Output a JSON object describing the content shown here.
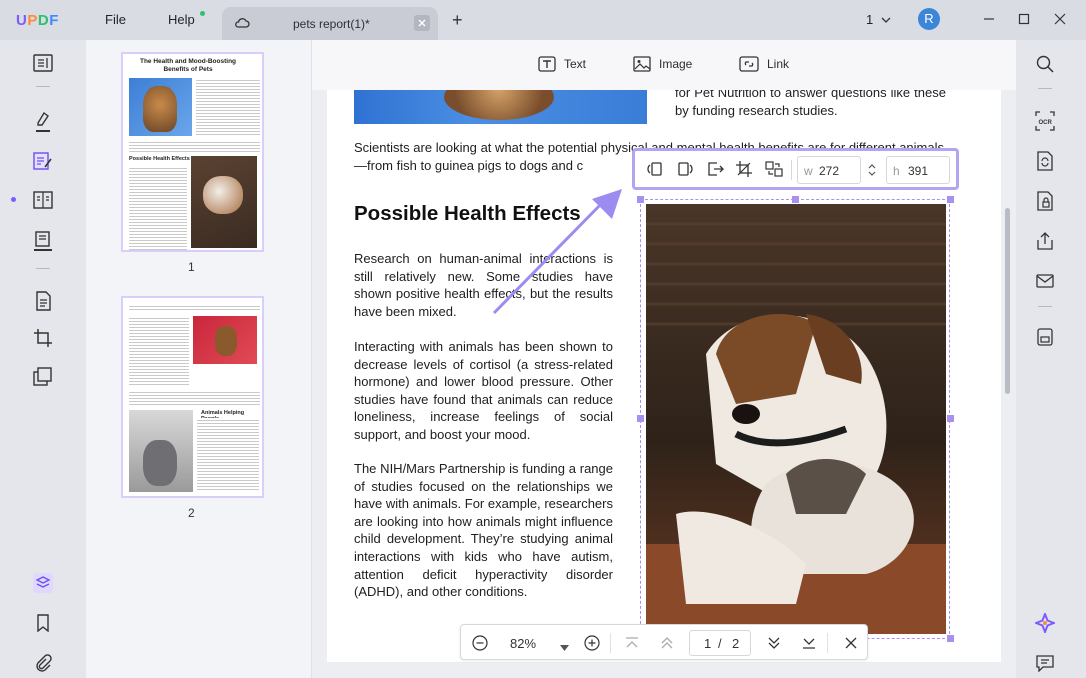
{
  "app": {
    "logo_text": "UPDF"
  },
  "menu": {
    "file": "File",
    "help": "Help"
  },
  "tab": {
    "title": "pets report(1)*"
  },
  "window": {
    "page_selector": "1",
    "avatar_initial": "R"
  },
  "toolbar": {
    "text_label": "Text",
    "image_label": "Image",
    "link_label": "Link"
  },
  "thumbnails": [
    {
      "page": "1",
      "title": "The Health and Mood-Boosting Benefits of Pets",
      "heading": "Possible Health Effects"
    },
    {
      "page": "2",
      "heading": "Animals Helping People"
    }
  ],
  "document": {
    "top_right_text": "for Pet Nutrition to answer questions like these by funding research studies.",
    "intro": "Scientists are looking at what the potential physical and mental health benefits are for different animals—from fish to guinea pigs to dogs and c",
    "heading": "Possible Health Effects",
    "para1": "Research on human-animal interactions is still relatively new. Some studies have shown positive health effects, but the results have been mixed.",
    "para2": "Interacting with animals has been shown to decrease levels of cortisol (a stress-related hormone) and lower blood pressure. Other studies have found that animals can reduce loneliness, increase feelings of social support, and boost your mood.",
    "para3": "The NIH/Mars Partnership is funding a range of studies focused on the relationships we have with animals. For example, researchers are looking into how animals might influence child development. They’re studying animal interactions with kids who have autism, attention deficit hyperactivity disorder (ADHD), and other conditions."
  },
  "image_tools": {
    "width_label": "w",
    "width_value": "272",
    "height_label": "h",
    "height_value": "391"
  },
  "bottom": {
    "zoom": "82%",
    "current_page": "1",
    "separator": "/",
    "total_pages": "2"
  },
  "colors": {
    "accent": "#7b5cff",
    "selection": "#a890f0"
  }
}
